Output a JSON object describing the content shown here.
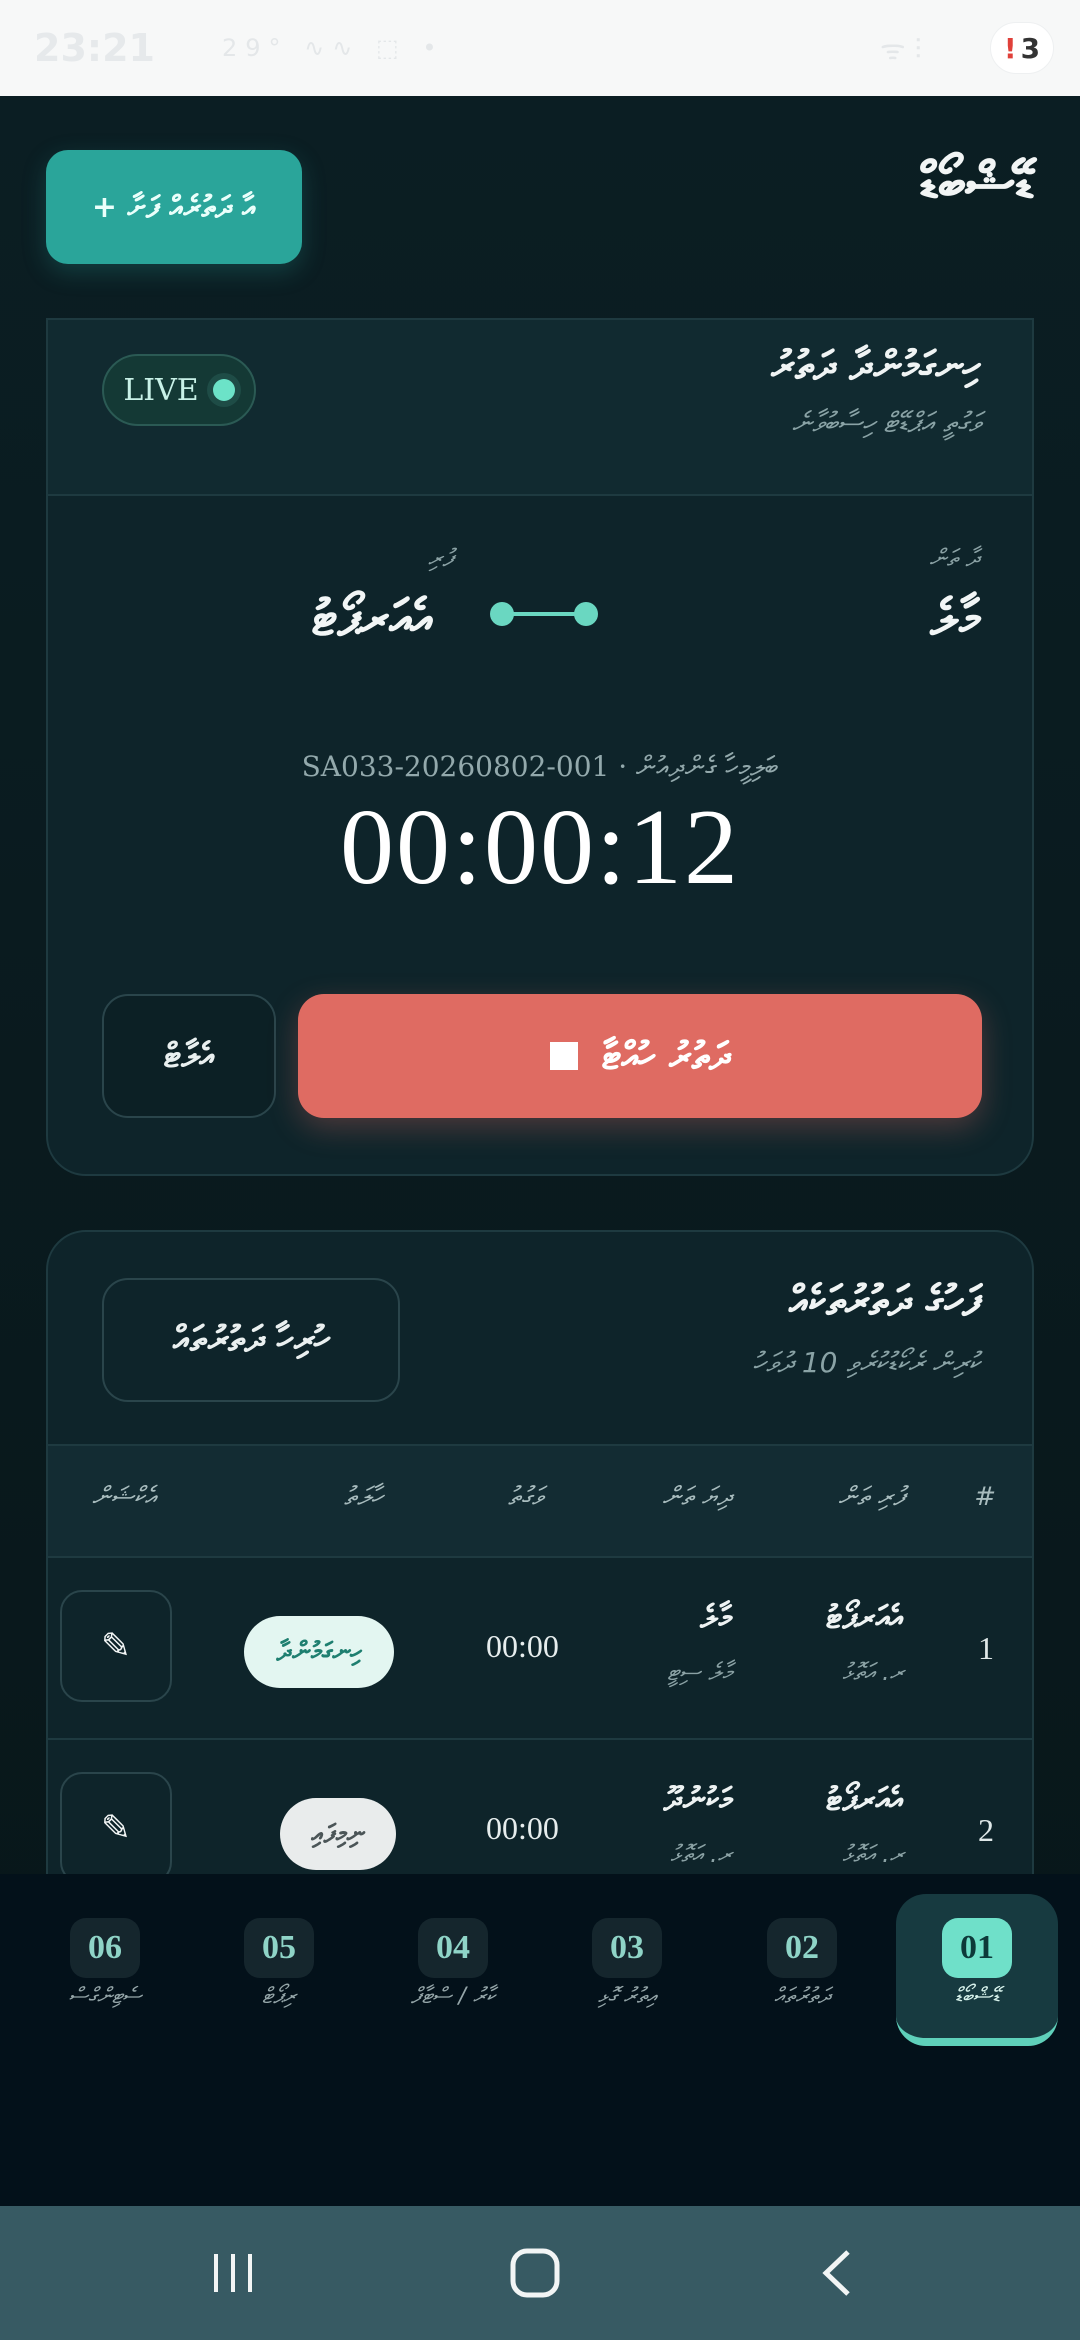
{
  "status_bar": {
    "time": "23:21",
    "left_icons_text": "29° ∿∿ ⬚ •",
    "right_icons_text": "ᯤ ⫶",
    "notification_count": "3"
  },
  "header": {
    "title": "ޑޭޝްބޯޑް",
    "add_button_label": "+ އާ ދަތުރެއް ފަށާ"
  },
  "live_card": {
    "title": "ހިނގަމުންދާ ދަތުރު",
    "subtitle": "ވަގުތީ އަޕްޑޭޓް ހިސާބުވާނެ",
    "live_label": "LIVE",
    "from_label": "ދާ ތަން",
    "from_name": "މާލެ",
    "to_label": "ފުރި",
    "to_name": "އެއަރޕޯޓު",
    "trip_id": "SA033-20260802-001 · ބަލިމީހާ ގެންދިއުން",
    "timer": "00:00:12",
    "stop_button_label": "ދަތުރު ހުއްޓާ",
    "aux_button_label": "އެލާޓް"
  },
  "recent_card": {
    "title": "ފަހުގެ ދަތުރުތަކެއް",
    "subtitle": "ކުރިން ރެކޯޑުކުރެވި 10 ދުވަހު",
    "all_button_label": "ހުރިހާ ދަތުރުތައް",
    "columns": [
      "#",
      "ފުރި ތަން",
      "ދިޔަ ތަން",
      "ވަގުތު",
      "ހާލަތު",
      "އެކްޝަން"
    ],
    "rows": [
      {
        "num": "1",
        "to": "އެއަރޕޯޓު",
        "to_sub": "ރ. އަތޮޅު",
        "from": "މާލެ",
        "from_sub": "މާލެ ސިޓީ",
        "duration": "00:00",
        "status": "ހިނގަމުންދާ",
        "edit": "✎"
      },
      {
        "num": "2",
        "to": "އެއަރޕޯޓު",
        "to_sub": "ރ. އަތޮޅު",
        "from": "މަކުނުދޫ",
        "from_sub": "ރ. އަތޮޅު",
        "duration": "00:00",
        "status": "ނިމިފައި",
        "edit": "✎"
      }
    ]
  },
  "tabs": [
    {
      "num": "01",
      "label": "ޑޭޝްބޯޑް"
    },
    {
      "num": "02",
      "label": "ދަތުރުތައް"
    },
    {
      "num": "03",
      "label": "އިތުރު ގޮޅި"
    },
    {
      "num": "04",
      "label": "ކާރު / ސްޓާފް"
    },
    {
      "num": "05",
      "label": "ރިޕޯޓް"
    },
    {
      "num": "06",
      "label": "ސެޓިންގްސް"
    }
  ],
  "colors": {
    "accent": "#2aa59a",
    "stop": "#df6b62",
    "background": "#0b1e23"
  }
}
